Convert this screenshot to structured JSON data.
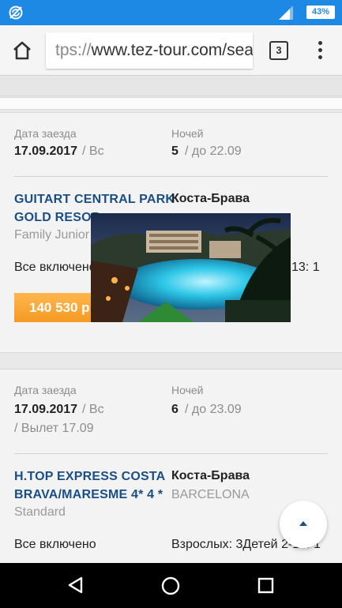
{
  "status_bar": {
    "battery": "43%"
  },
  "browser": {
    "url_scheme": "tps://",
    "url_host": "www.tez-tour.com/sea",
    "tab_count": "3"
  },
  "tours": [
    {
      "checkin_label": "Дата заезда",
      "checkin_date": "17.09.2017",
      "checkin_day": "/ Вс",
      "nights_label": "Ночей",
      "nights": "5",
      "until": "/ до 22.09",
      "hotel_line1": "GUITART CENTRAL PARK",
      "hotel_line2": "GOLD  RESOR",
      "room": "Family Junior",
      "region": "Коста-Брава",
      "meal": "Все включено",
      "guests_partial": "13: 1",
      "price": "140 530 р"
    },
    {
      "checkin_label": "Дата заезда",
      "checkin_date": "17.09.2017",
      "checkin_day": "/ Вс",
      "departure": "/ Вылет 17.09",
      "nights_label": "Ночей",
      "nights": "6",
      "until": "/ до 23.09",
      "hotel_line1": "H.TOP EXPRESS COSTA",
      "hotel_line2": "BRAVA/MARESME 4* 4 *",
      "room": "Standard",
      "region": "Коста-Брава",
      "city": "BARCELONA",
      "meal": "Все включено",
      "guests": "Взрослых: 3Детей 2-14: 1"
    }
  ],
  "colors": {
    "status_bar": "#1e88e5",
    "hotel_link": "#1a4e86",
    "price_button": "#f59a23"
  }
}
